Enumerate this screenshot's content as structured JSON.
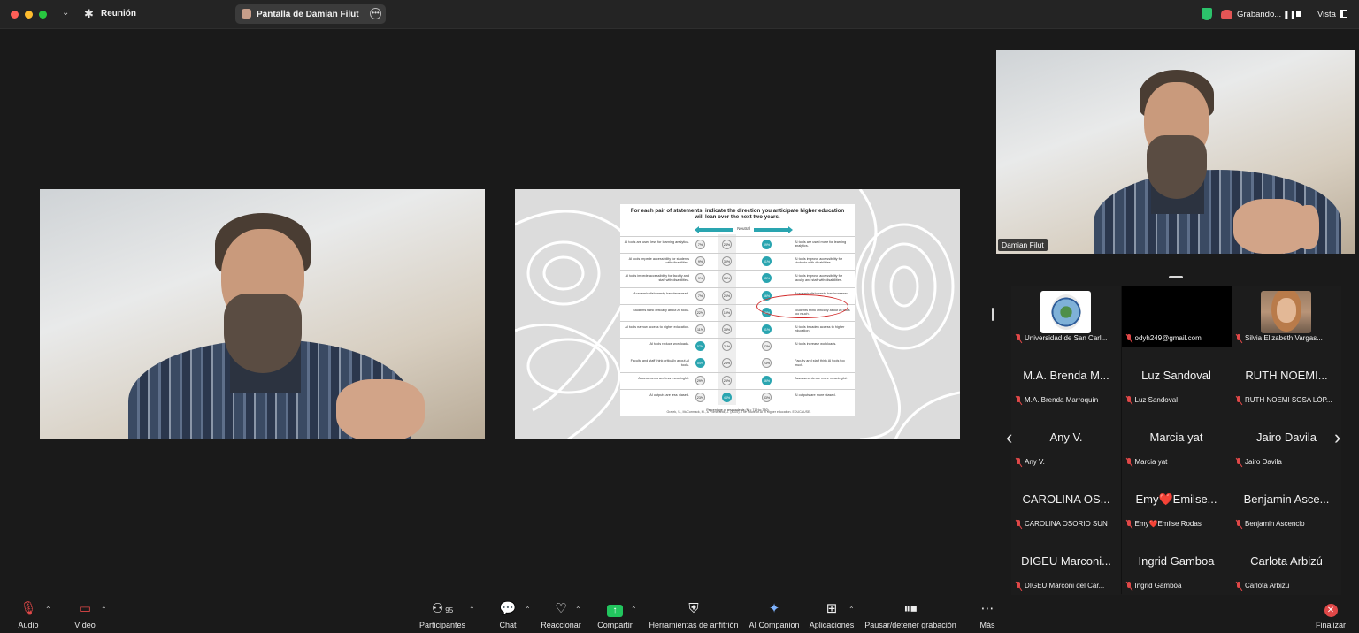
{
  "topbar": {
    "meeting_title": "Reunión",
    "share_pill_label": "Pantalla de Damian Filut",
    "recording_label": "Grabando...",
    "view_label": "Vista"
  },
  "video": {
    "self_name": "Damian Filut"
  },
  "slide": {
    "title": "For each pair of statements, indicate the direction you anticipate higher education will lean over the next two years.",
    "neutral_label": "Neutral",
    "axis_caption": "Percentage of respondents (N = 719 to 730)",
    "citation": "Grajek, S., McCormack, M., & Pomerantz, J. (2025). The future of AI in higher education. EDUCAUSE.",
    "rows": [
      {
        "left": "AI tools are used less for learning analytics.",
        "right": "AI tools are used more for learning analytics.",
        "v": [
          "7%",
          "24%",
          "69%"
        ],
        "hi": 2
      },
      {
        "left": "AI tools impede accessibility for students with disabilities.",
        "right": "AI tools improve accessibility for students with disabilities.",
        "v": [
          "9%",
          "30%",
          "61%"
        ],
        "hi": 2
      },
      {
        "left": "AI tools impede accessibility for faculty and staff with disabilities.",
        "right": "AI tools improve accessibility for faculty and staff with disabilities.",
        "v": [
          "9%",
          "36%",
          "55%"
        ],
        "hi": 2
      },
      {
        "left": "Academic dishonesty has decreased.",
        "right": "Academic dishonesty has increased.",
        "v": [
          "7%",
          "26%",
          "66%"
        ],
        "hi": 2
      },
      {
        "left": "Students think critically about AI tools.",
        "right": "Students think critically about AI tools too much.",
        "v": [
          "22%",
          "19%",
          "59%"
        ],
        "hi": 2
      },
      {
        "left": "AI tools narrow access to higher education.",
        "right": "AI tools broaden access to higher education.",
        "v": [
          "11%",
          "38%",
          "51%"
        ],
        "hi": 2
      },
      {
        "left": "AI tools reduce workloads.",
        "right": "AI tools increase workloads.",
        "v": [
          "57%",
          "21%",
          "22%"
        ],
        "hi": 0
      },
      {
        "left": "Faculty and staff think critically about AI tools.",
        "right": "Faculty and staff think AI tools too much.",
        "v": [
          "54%",
          "23%",
          "23%"
        ],
        "hi": 0
      },
      {
        "left": "Assessments are less meaningful.",
        "right": "Assessments are more meaningful.",
        "v": [
          "29%",
          "25%",
          "46%"
        ],
        "hi": 2
      },
      {
        "left": "AI outputs are less biased.",
        "right": "AI outputs are more biased.",
        "v": [
          "23%",
          "44%",
          "33%"
        ],
        "hi": 1
      }
    ]
  },
  "gallery": {
    "participants": [
      {
        "big": "",
        "small": "Universidad de San Carl...",
        "avatar": "seal"
      },
      {
        "big": "",
        "small": "odyh249@gmail.com",
        "avatar": "black"
      },
      {
        "big": "",
        "small": "Silvia Elizabeth Vargas...",
        "avatar": "face"
      },
      {
        "big": "M.A. Brenda M...",
        "small": "M.A. Brenda Marroquín"
      },
      {
        "big": "Luz Sandoval",
        "small": "Luz Sandoval"
      },
      {
        "big": "RUTH NOEMI...",
        "small": "RUTH NOEMI SOSA LÓP..."
      },
      {
        "big": "Any V.",
        "small": "Any V."
      },
      {
        "big": "Marcia yat",
        "small": "Marcia yat"
      },
      {
        "big": "Jairo Davila",
        "small": "Jairo Davila"
      },
      {
        "big": "CAROLINA OS...",
        "small": "CAROLINA OSORIO SUN"
      },
      {
        "big": "Emy❤️Emilse...",
        "small": "Emy❤️Emilse Rodas"
      },
      {
        "big": "Benjamin Asce...",
        "small": "Benjamin Ascencio"
      },
      {
        "big": "DIGEU Marconi...",
        "small": "DIGEU Marconi del Car..."
      },
      {
        "big": "Ingrid Gamboa",
        "small": "Ingrid Gamboa"
      },
      {
        "big": "Carlota Arbizú",
        "small": "Carlota Arbizú"
      }
    ]
  },
  "toolbar": {
    "audio": "Audio",
    "video": "Vídeo",
    "participants": "Participantes",
    "participants_count": "95",
    "chat": "Chat",
    "react": "Reaccionar",
    "share": "Compartir",
    "host_tools": "Herramientas de anfitrión",
    "ai_companion": "AI Companion",
    "apps": "Aplicaciones",
    "pause_record": "Pausar/detener grabación",
    "more": "Más",
    "end": "Finalizar"
  },
  "colors": {
    "accent_teal": "#2aa5b0",
    "share_green": "#22c55e",
    "end_red": "#e04848",
    "highlight_red": "#d22c2c"
  }
}
